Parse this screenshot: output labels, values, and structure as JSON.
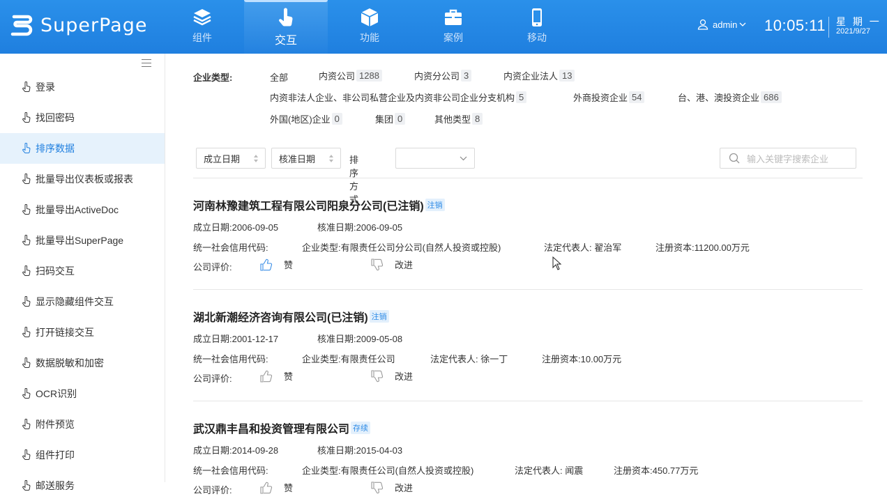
{
  "brand": {
    "name": "SuperPage"
  },
  "nav": [
    {
      "label": "组件",
      "icon": "layers-icon"
    },
    {
      "label": "交互",
      "icon": "touch-icon",
      "active": true
    },
    {
      "label": "功能",
      "icon": "cube-icon"
    },
    {
      "label": "案例",
      "icon": "briefcase-icon"
    },
    {
      "label": "移动",
      "icon": "mobile-icon"
    }
  ],
  "user": {
    "name": "admin"
  },
  "clock": {
    "time": "10:05:11",
    "weekday": "星 期 一",
    "date": "2021/9/27"
  },
  "sidebar": {
    "items": [
      {
        "label": "登录"
      },
      {
        "label": "找回密码"
      },
      {
        "label": "排序数据",
        "active": true
      },
      {
        "label": "批量导出仪表板或报表"
      },
      {
        "label": "批量导出ActiveDoc"
      },
      {
        "label": "批量导出SuperPage"
      },
      {
        "label": "扫码交互"
      },
      {
        "label": "显示隐藏组件交互"
      },
      {
        "label": "打开链接交互"
      },
      {
        "label": "数据脱敏和加密"
      },
      {
        "label": "OCR识别"
      },
      {
        "label": "附件预览"
      },
      {
        "label": "组件打印"
      },
      {
        "label": "邮送服务"
      }
    ]
  },
  "filter": {
    "label": "企业类型:",
    "all": "全部",
    "options": [
      {
        "label": "内资公司",
        "count": "1288"
      },
      {
        "label": "内资分公司",
        "count": "3"
      },
      {
        "label": "内资企业法人",
        "count": "13"
      },
      {
        "label": "内资非法人企业、非公司私营企业及内资非公司企业分支机构",
        "count": "5"
      },
      {
        "label": "外商投资企业",
        "count": "54"
      },
      {
        "label": "台、港、澳投资企业",
        "count": "686"
      },
      {
        "label": "外国(地区)企业",
        "count": "0"
      },
      {
        "label": "集团",
        "count": "0"
      },
      {
        "label": "其他类型",
        "count": "8"
      }
    ]
  },
  "sort": {
    "field1": "成立日期",
    "field2": "核准日期",
    "method_label": "排序方式",
    "method_value": "",
    "search_placeholder": "输入关键字搜索企业"
  },
  "labels": {
    "established": "成立日期:",
    "approved": "核准日期:",
    "credit_code": "统一社会信用代码:",
    "company_type": "企业类型:",
    "legal_rep": "法定代表人:",
    "capital": "注册资本:",
    "rating": "公司评价:",
    "like": "赞",
    "improve": "改进"
  },
  "companies": [
    {
      "name": "河南林豫建筑工程有限公司阳泉分公司(已注销)",
      "status": "注销",
      "established": "2006-09-05",
      "approved": "2006-09-05",
      "type": "有限责任公司分公司(自然人投资或控股)",
      "legal_rep": "翟治军",
      "capital": "11200.00万元"
    },
    {
      "name": "湖北新潮经济咨询有限公司(已注销)",
      "status": "注销",
      "established": "2001-12-17",
      "approved": "2009-05-08",
      "type": "有限责任公司",
      "legal_rep": "徐一丁",
      "capital": "10.00万元"
    },
    {
      "name": "武汉鼎丰昌和投资管理有限公司",
      "status": "存续",
      "established": "2014-09-28",
      "approved": "2015-04-03",
      "type": "有限责任公司(自然人投资或控股)",
      "legal_rep": "闻震",
      "capital": "450.77万元"
    }
  ],
  "colors": {
    "primary": "#1f7fdf",
    "tag_bg": "#e3f0fc"
  }
}
